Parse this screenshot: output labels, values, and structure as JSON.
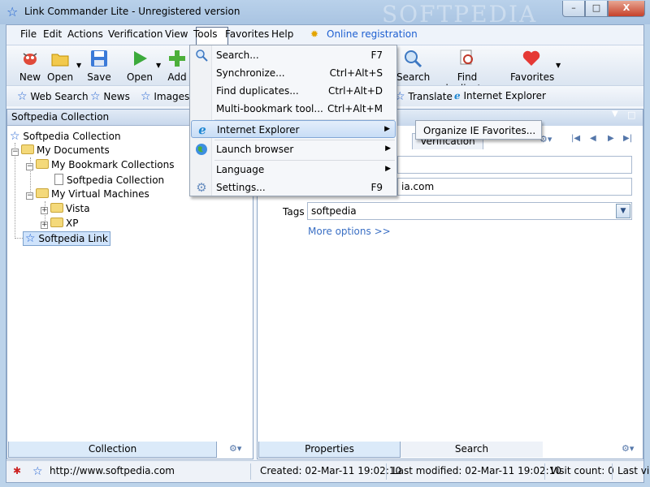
{
  "window": {
    "title": "Link Commander Lite - Unregistered version",
    "min": "–",
    "max": "□",
    "close": "X",
    "watermark": "SOFTPEDIA"
  },
  "menubar": {
    "items": [
      "File",
      "Edit",
      "Actions",
      "Verification",
      "View",
      "Tools",
      "Favorites",
      "Help"
    ],
    "registration": "Online registration"
  },
  "toolbar": {
    "new": "New",
    "open": "Open",
    "save": "Save",
    "open2": "Open",
    "add": "Add",
    "search": "Search",
    "find_duplicates": "Find duplicates",
    "favorites": "Favorites"
  },
  "linkbar": {
    "web_search": "Web Search",
    "news": "News",
    "images": "Images",
    "translate": "Translate",
    "internet_explorer": "Internet Explorer"
  },
  "left": {
    "header": "Softpedia Collection",
    "tree": {
      "root": "Softpedia Collection",
      "my_documents": "My Documents",
      "my_bookmark_collections": "My Bookmark Collections",
      "softpedia_collection": "Softpedia Collection",
      "my_virtual_machines": "My Virtual Machines",
      "vista": "Vista",
      "xp": "XP",
      "softpedia_link": "Softpedia Link"
    },
    "tab": "Collection"
  },
  "right": {
    "tab_verification": "Verification",
    "url_partial": "ia.com",
    "tags_label": "Tags",
    "tags_value": "softpedia",
    "more_options": "More options >>",
    "tab_properties": "Properties",
    "tab_search": "Search"
  },
  "tools_menu": {
    "items": [
      {
        "label": "Search...",
        "shortcut": "F7"
      },
      {
        "label": "Synchronize...",
        "shortcut": "Ctrl+Alt+S"
      },
      {
        "label": "Find duplicates...",
        "shortcut": "Ctrl+Alt+D"
      },
      {
        "label": "Multi-bookmark tool...",
        "shortcut": "Ctrl+Alt+M"
      },
      {
        "label": "Internet Explorer",
        "shortcut": ""
      },
      {
        "label": "Launch browser",
        "shortcut": ""
      },
      {
        "label": "Language",
        "shortcut": ""
      },
      {
        "label": "Settings...",
        "shortcut": "F9"
      }
    ],
    "ie_submenu": "Organize IE Favorites..."
  },
  "statusbar": {
    "url": "http://www.softpedia.com",
    "created": "Created: 02-Mar-11 19:02:10",
    "modified": "Last modified: 02-Mar-11 19:02:10",
    "visits": "Visit count: 0",
    "last_visit": "Last vi"
  },
  "colors": {
    "accent": "#1d5fd1",
    "highlight": "#cfe3fb",
    "menu_hover_border": "#82a7d6"
  }
}
